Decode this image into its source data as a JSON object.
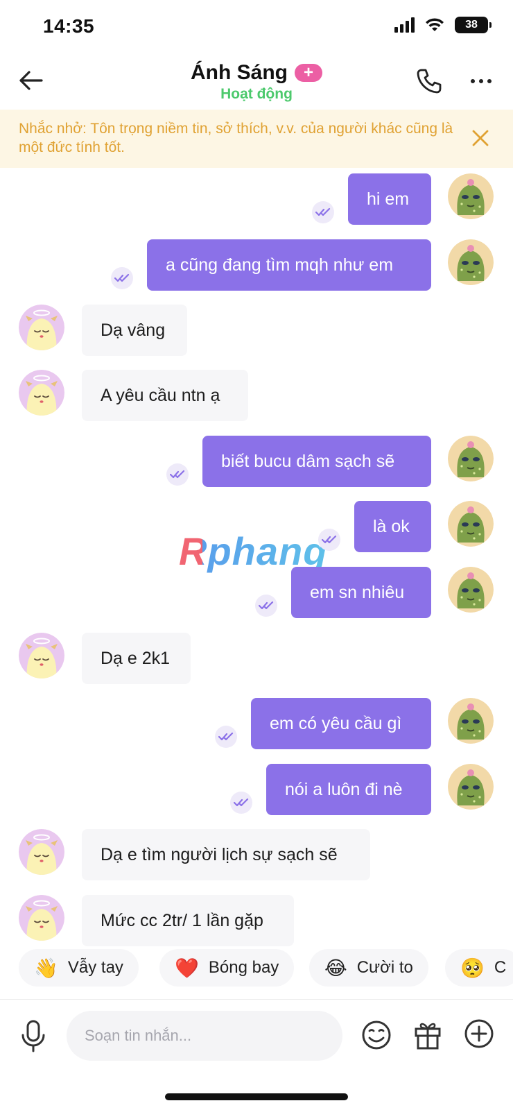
{
  "status_bar": {
    "time": "14:35",
    "battery": "38"
  },
  "header": {
    "back_icon": "arrow-left-icon",
    "name": "Ánh Sáng",
    "badge": "+",
    "status": "Hoạt động",
    "status_color": "#4cc96c",
    "call_icon": "phone-icon",
    "more_icon": "ellipsis-icon"
  },
  "reminder": {
    "text": "Nhắc nhở: Tôn trọng niềm tin, sở thích, v.v. của người khác cũng là một đức tính tốt.",
    "close_icon": "close-icon"
  },
  "watermark": "Rphang",
  "messages": [
    {
      "direction": "out",
      "text": "hi em",
      "read": true
    },
    {
      "direction": "out",
      "text": "a cũng đang tìm mqh như em",
      "read": true
    },
    {
      "direction": "in",
      "text": "Dạ vâng"
    },
    {
      "direction": "in",
      "text": "A yêu cầu ntn ạ"
    },
    {
      "direction": "out",
      "text": "biết bucu dâm sạch sẽ",
      "read": true
    },
    {
      "direction": "out",
      "text": "là ok",
      "read": true
    },
    {
      "direction": "out",
      "text": "em sn nhiêu",
      "read": true
    },
    {
      "direction": "in",
      "text": "Dạ e 2k1"
    },
    {
      "direction": "out",
      "text": "em có yêu cầu gì",
      "read": true
    },
    {
      "direction": "out",
      "text": "nói a luôn đi nè",
      "read": true
    },
    {
      "direction": "in",
      "text": "Dạ e tìm người lịch sự sạch sẽ"
    },
    {
      "direction": "in",
      "text": "Mức cc 2tr/ 1 lần gặp"
    }
  ],
  "quick_reactions": [
    {
      "emoji": "👋",
      "label": "Vẫy tay"
    },
    {
      "emoji": "❤️",
      "label": "Bóng bay"
    },
    {
      "emoji": "😂",
      "label": "Cười to"
    },
    {
      "emoji": "🥺",
      "label": "C"
    }
  ],
  "composer": {
    "mic_icon": "microphone-icon",
    "placeholder": "Soạn tin nhắn...",
    "emoji_icon": "smiley-icon",
    "gift_icon": "gift-icon",
    "add_icon": "plus-circle-icon"
  },
  "colors": {
    "outgoing_bubble": "#8b71e8",
    "incoming_bubble": "#f6f6f8",
    "reminder_bg": "#fdf6e4",
    "reminder_text": "#e0a233",
    "badge": "#ec5fa4"
  }
}
